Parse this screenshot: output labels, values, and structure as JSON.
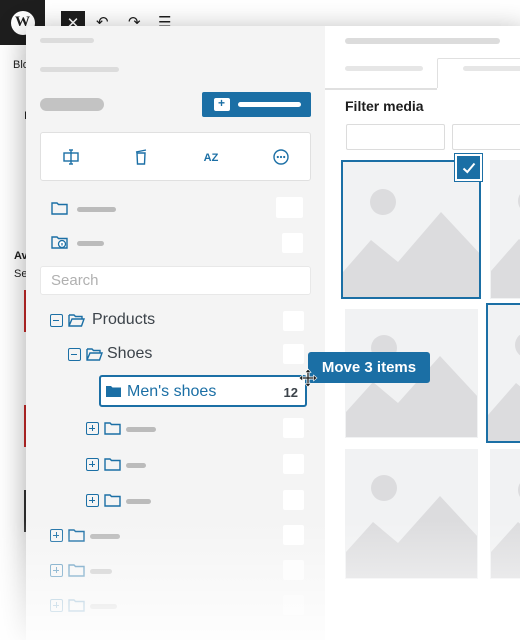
{
  "editor": {
    "logo_label": "W",
    "close_label": "✕",
    "undo_label": "↶",
    "redo_label": "↷",
    "menu_label": "☰",
    "sidebar_tab_fragment": "Blo",
    "frag_i": "I",
    "frag_av": "Av",
    "frag_se": "Se"
  },
  "media_folders": {
    "search": {
      "placeholder": "Search",
      "value": ""
    },
    "toolbar": {
      "icons": [
        "rename-icon",
        "delete-icon",
        "sort-az-icon",
        "more-options-icon"
      ],
      "sort_label": "AZ",
      "more_label": "⋯"
    },
    "tree": {
      "products_label": "Products",
      "shoes_label": "Shoes",
      "mens_shoes_label": "Men's shoes",
      "mens_shoes_count": "12"
    },
    "drag": {
      "tooltip": "Move 3 items"
    }
  },
  "media_library": {
    "filter_title": "Filter media",
    "selected_count": 2,
    "accent_color": "#1b6fa5"
  }
}
